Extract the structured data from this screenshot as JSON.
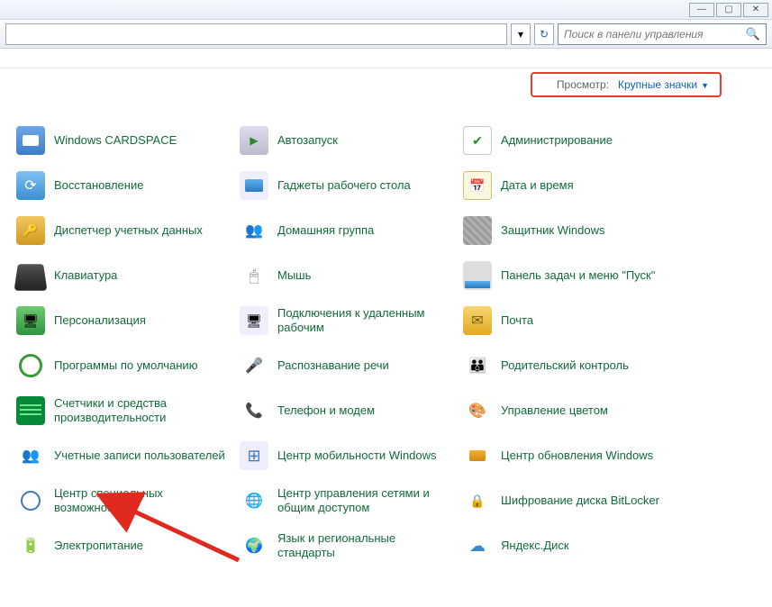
{
  "window": {
    "min": "—",
    "max": "▢",
    "close": "✕"
  },
  "search": {
    "placeholder": "Поиск в панели управления"
  },
  "view": {
    "label": "Просмотр:",
    "value": "Крупные значки"
  },
  "items": [
    {
      "label": "Windows CARDSPACE",
      "icon": "i-cardspace",
      "name": "cardspace"
    },
    {
      "label": "Автозапуск",
      "icon": "i-autorun",
      "name": "autoplay"
    },
    {
      "label": "Администрирование",
      "icon": "i-admin",
      "name": "admin-tools"
    },
    {
      "label": "Восстановление",
      "icon": "i-restore",
      "name": "recovery"
    },
    {
      "label": "Гаджеты рабочего стола",
      "icon": "i-gadgets",
      "name": "desktop-gadgets"
    },
    {
      "label": "Дата и время",
      "icon": "i-datetime",
      "name": "date-time"
    },
    {
      "label": "Диспетчер учетных данных",
      "icon": "i-credmgr",
      "name": "credential-manager"
    },
    {
      "label": "Домашняя группа",
      "icon": "i-homegroup",
      "name": "homegroup"
    },
    {
      "label": "Защитник Windows",
      "icon": "i-defender",
      "name": "windows-defender"
    },
    {
      "label": "Клавиатура",
      "icon": "i-keyboard",
      "name": "keyboard"
    },
    {
      "label": "Мышь",
      "icon": "i-mouse",
      "name": "mouse"
    },
    {
      "label": "Панель задач и меню \"Пуск\"",
      "icon": "i-taskbar",
      "name": "taskbar-startmenu"
    },
    {
      "label": "Персонализация",
      "icon": "i-personal",
      "name": "personalization"
    },
    {
      "label": "Подключения к удаленным рабочим",
      "icon": "i-remote",
      "name": "remote-desktop"
    },
    {
      "label": "Почта",
      "icon": "i-mail",
      "name": "mail"
    },
    {
      "label": "Программы по умолчанию",
      "icon": "i-defaults",
      "name": "default-programs"
    },
    {
      "label": "Распознавание речи",
      "icon": "i-speech",
      "name": "speech-recognition"
    },
    {
      "label": "Родительский контроль",
      "icon": "i-parental",
      "name": "parental-controls"
    },
    {
      "label": "Счетчики и средства производительности",
      "icon": "i-perf",
      "name": "performance"
    },
    {
      "label": "Телефон и модем",
      "icon": "i-phone",
      "name": "phone-modem"
    },
    {
      "label": "Управление цветом",
      "icon": "i-color",
      "name": "color-management"
    },
    {
      "label": "Учетные записи пользователей",
      "icon": "i-users",
      "name": "user-accounts"
    },
    {
      "label": "Центр мобильности Windows",
      "icon": "i-mobility",
      "name": "mobility-center"
    },
    {
      "label": "Центр обновления Windows",
      "icon": "i-update",
      "name": "windows-update"
    },
    {
      "label": "Центр специальных возможностей",
      "icon": "i-access",
      "name": "ease-of-access"
    },
    {
      "label": "Центр управления сетями и общим доступом",
      "icon": "i-network",
      "name": "network-sharing"
    },
    {
      "label": "Шифрование диска BitLocker",
      "icon": "i-bitlocker",
      "name": "bitlocker"
    },
    {
      "label": "Электропитание",
      "icon": "i-power",
      "name": "power-options"
    },
    {
      "label": "Язык и региональные стандарты",
      "icon": "i-lang",
      "name": "region-language"
    },
    {
      "label": "Яндекс.Диск",
      "icon": "i-yadisk",
      "name": "yandex-disk"
    }
  ]
}
